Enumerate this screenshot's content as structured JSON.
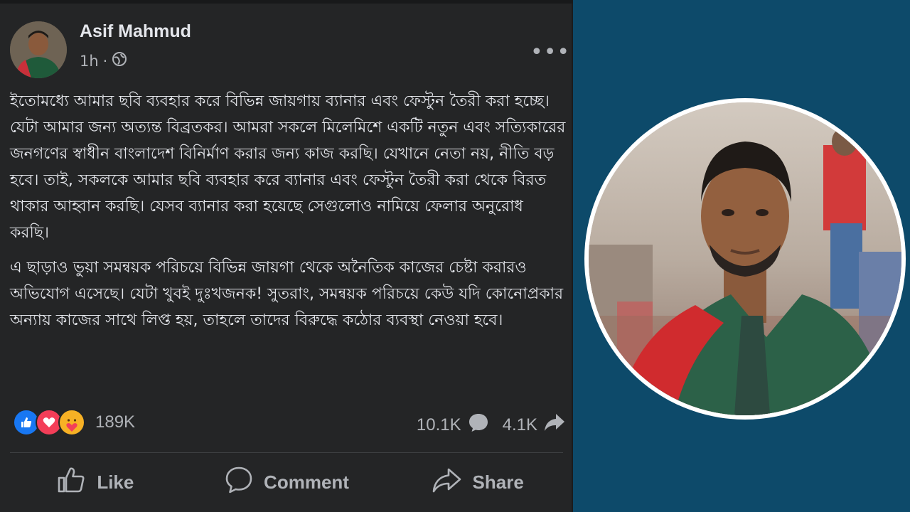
{
  "post": {
    "author": "Asif Mahmud",
    "time": "1h",
    "time_separator": "·",
    "more_label": "•••",
    "paragraphs": [
      "ইতোমধ্যে আমার ছবি ব্যবহার করে বিভিন্ন জায়গায় ব্যানার এবং ফেস্টুন তৈরী করা হচ্ছে। যেটা আমার জন্য অত্যন্ত বিব্রতকর। আমরা সকলে মিলেমিশে একটি নতুন এবং সত্যিকারের জনগণের স্বাধীন বাংলাদেশ বিনির্মাণ করার জন্য কাজ করছি। যেখানে নেতা নয়, নীতি বড় হবে। তাই, সকলকে আমার ছবি ব্যবহার করে ব্যানার এবং ফেস্টুন তৈরী করা থেকে বিরত থাকার আহ্বান করছি। যেসব ব্যানার করা হয়েছে সেগুলোও নামিয়ে ফেলার অনুরোধ করছি।",
      "এ ছাড়াও ভুয়া সমন্বয়ক পরিচয়ে বিভিন্ন জায়গা থেকে অনৈতিক কাজের চেষ্টা করারও অভিযোগ এসেছে। যেটা খুবই দুঃখজনক! সুতরাং, সমন্বয়ক পরিচয়ে কেউ যদি কোনোপ্রকার অন্যায় কাজের সাথে লিপ্ত হয়, তাহলে তাদের বিরুদ্ধে কঠোর ব্যবস্থা নেওয়া হবে।"
    ],
    "reaction_count": "189K",
    "comment_count": "10.1K",
    "share_count": "4.1K",
    "actions": {
      "like": "Like",
      "comment": "Comment",
      "share": "Share"
    }
  },
  "colors": {
    "post_bg": "#242526",
    "page_bg": "#0d4a6a",
    "text_primary": "#e4e6eb",
    "text_secondary": "#b0b3b8",
    "like_blue": "#1877f2",
    "love_red": "#f33e58",
    "care_yellow": "#f7b125"
  },
  "icons": [
    "globe-icon",
    "like-reaction-icon",
    "love-reaction-icon",
    "care-reaction-icon",
    "comment-icon",
    "share-icon",
    "thumbs-up-icon",
    "comment-bubble-icon",
    "share-arrow-icon"
  ]
}
